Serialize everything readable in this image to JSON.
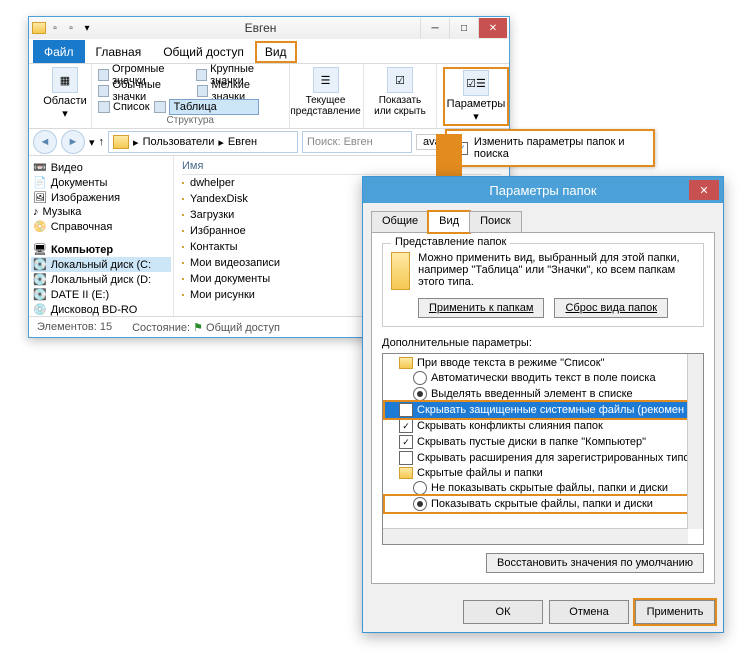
{
  "explorer": {
    "title": "Евген",
    "tabs": {
      "file": "Файл",
      "home": "Главная",
      "share": "Общий доступ",
      "view": "Вид"
    },
    "ribbon": {
      "panes_label": "Области",
      "layout": {
        "huge": "Огромные значки",
        "large": "Крупные значки",
        "medium": "Обычные значки",
        "small": "Мелкие значки",
        "list": "Список",
        "table": "Таблица",
        "group_label": "Структура"
      },
      "current_view": "Текущее представление",
      "show_hide": "Показать или скрыть",
      "options": "Параметры",
      "options_sub": "Изменить параметры папок и поиска"
    },
    "breadcrumb": {
      "users": "Пользователи",
      "user": "Евген"
    },
    "search_ph": "Поиск: Евген",
    "avast": "avast! WebRep",
    "nav": [
      "Видео",
      "Документы",
      "Изображения",
      "Музыка",
      "Справочная",
      "Компьютер",
      "Локальный диск (C:",
      "Локальный диск (D:",
      "DATE II (E:)",
      "Дисковод BD-RO"
    ],
    "col_name": "Имя",
    "files": [
      "dwhelper",
      "YandexDisk",
      "Загрузки",
      "Избранное",
      "Контакты",
      "Мои видеозаписи",
      "Мои документы",
      "Мои рисунки"
    ],
    "status": {
      "count": "Элементов: 15",
      "state_lbl": "Состояние:",
      "share": "Общий доступ"
    }
  },
  "dialog": {
    "title": "Параметры папок",
    "tabs": {
      "general": "Общие",
      "view": "Вид",
      "search": "Поиск"
    },
    "fv_group": "Представление папок",
    "fv_text": "Можно применить вид, выбранный для этой папки, например \"Таблица\" или \"Значки\", ко всем папкам этого типа.",
    "apply_folders": "Применить к папкам",
    "reset_folders": "Сброс вида папок",
    "adv_label": "Дополнительные параметры:",
    "tree": {
      "t0": "При вводе текста в режиме \"Список\"",
      "t1": "Автоматически вводить текст в поле поиска",
      "t2": "Выделять введенный элемент в списке",
      "t3": "Скрывать защищенные системные файлы (рекомен",
      "t4": "Скрывать конфликты слияния папок",
      "t5": "Скрывать пустые диски в папке \"Компьютер\"",
      "t6": "Скрывать расширения для зарегистрированных типо",
      "t7": "Скрытые файлы и папки",
      "t8": "Не показывать скрытые файлы, папки и диски",
      "t9": "Показывать скрытые файлы, папки и диски"
    },
    "restore": "Восстановить значения по умолчанию",
    "ok": "ОК",
    "cancel": "Отмена",
    "apply": "Применить"
  }
}
